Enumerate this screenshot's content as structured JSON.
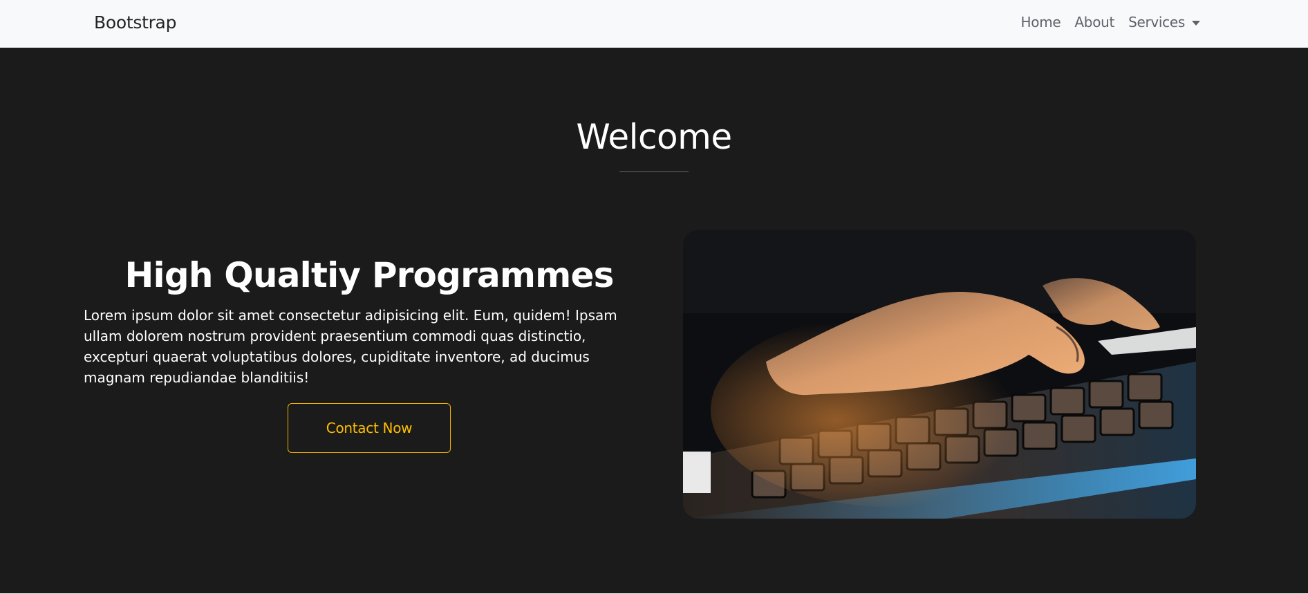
{
  "navbar": {
    "brand": "Bootstrap",
    "links": [
      {
        "label": "Home"
      },
      {
        "label": "About"
      },
      {
        "label": "Services"
      }
    ]
  },
  "hero": {
    "heading": "Welcome"
  },
  "feature": {
    "title": "High Qualtiy Programmes",
    "text": "Lorem ipsum dolor sit amet consectetur adipisicing elit. Eum, quidem! Ipsam ullam dolorem nostrum provident praesentium commodi quas distinctio, excepturi quaerat voluptatibus dolores, cupiditate inventore, ad ducimus magnam repudiandae blanditiis!",
    "button_label": "Contact Now"
  },
  "colors": {
    "navbar_bg": "#f8f9fa",
    "hero_bg": "#1b1b1b",
    "accent": "#ffbf00"
  },
  "icons": {
    "services_toggle": "caret-down-icon"
  }
}
